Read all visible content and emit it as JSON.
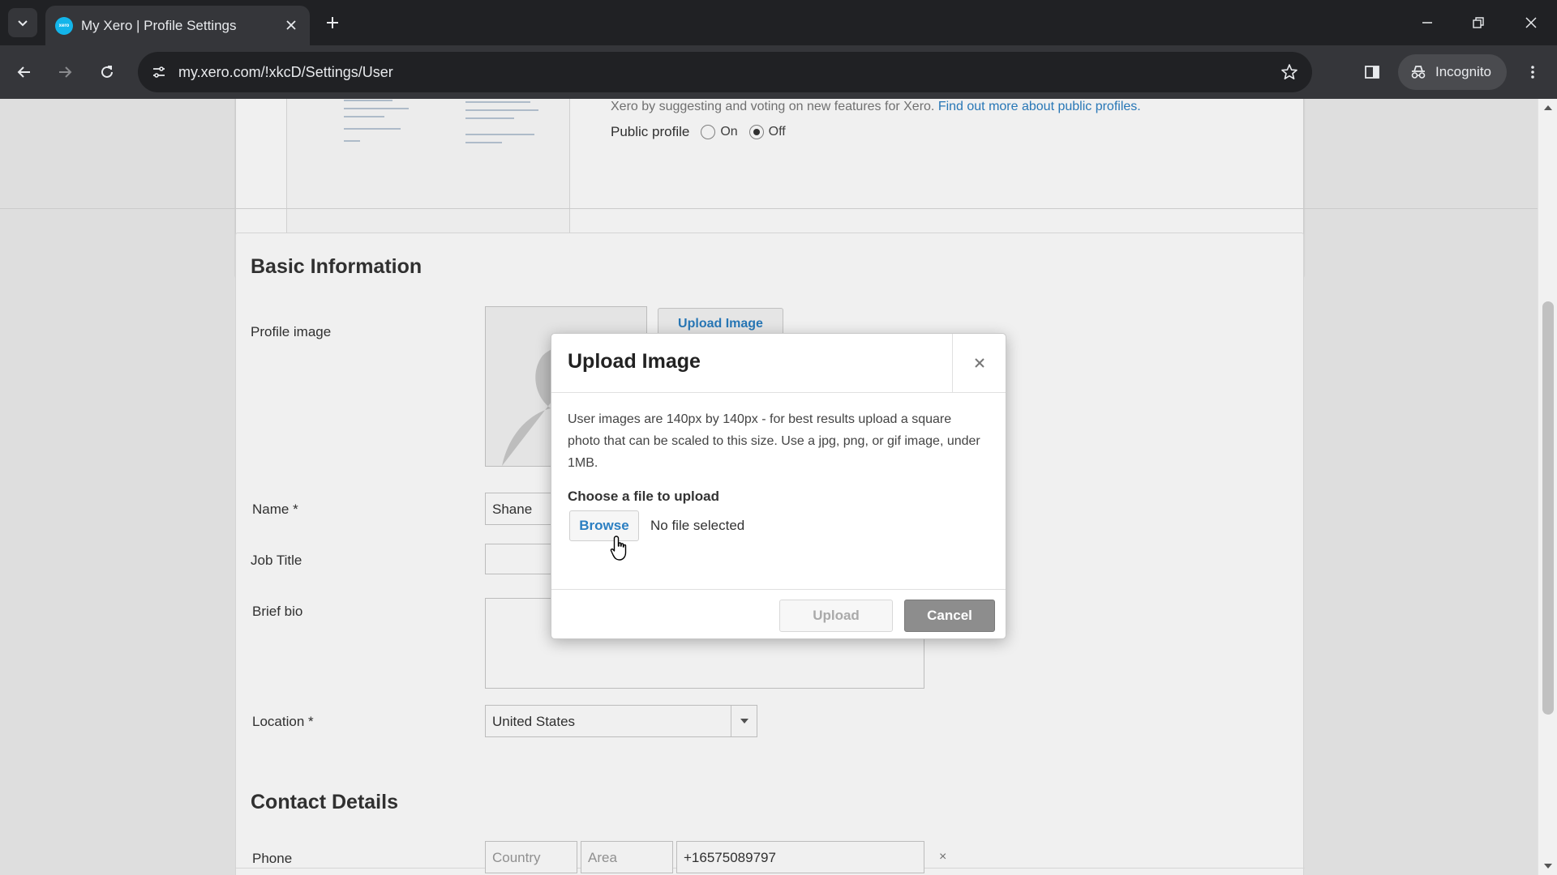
{
  "browser": {
    "tab_title": "My Xero | Profile Settings",
    "favicon_text": "xero",
    "url": "my.xero.com/!xkcD/Settings/User",
    "incognito_label": "Incognito"
  },
  "public_profile": {
    "cutoff_text": "Xero by suggesting and voting on new features for Xero.",
    "cutoff_link": "Find out more about public profiles.",
    "label": "Public profile",
    "option_on": "On",
    "option_off": "Off",
    "selected": "Off"
  },
  "basic_information": {
    "title": "Basic Information",
    "profile_image_label": "Profile image",
    "upload_image_button": "Upload Image",
    "name_label": "Name *",
    "name_value": "Shane",
    "job_title_label": "Job Title",
    "job_title_value": "",
    "brief_bio_label": "Brief bio",
    "location_label": "Location *",
    "location_value": "United States"
  },
  "contact_details": {
    "title": "Contact Details",
    "phone_label": "Phone",
    "country_placeholder": "Country",
    "area_placeholder": "Area",
    "phone_value": "+16575089797",
    "remove_label": "×"
  },
  "modal": {
    "title": "Upload Image",
    "close_label": "×",
    "description": "User images are 140px by 140px - for best results upload a square photo that can be scaled to this size. Use a jpg, png, or gif image, under 1MB.",
    "choose_label": "Choose a file to upload",
    "browse_button": "Browse",
    "file_status": "No file selected",
    "upload_button": "Upload",
    "cancel_button": "Cancel"
  },
  "colors": {
    "link": "#2b7fc2",
    "chrome_dark": "#202124",
    "chrome_toolbar": "#35363a",
    "cancel_button": "#8d8d8d"
  }
}
